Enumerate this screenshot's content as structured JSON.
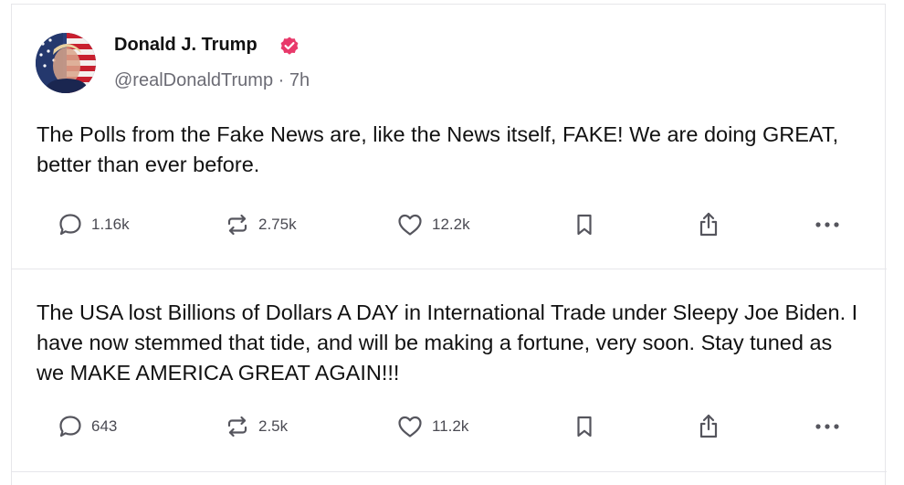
{
  "posts": [
    {
      "author": {
        "name": "Donald J. Trump",
        "handle": "@realDonaldTrump",
        "separator": "·",
        "time": "7h",
        "verified": true,
        "verified_color": "#e8396a"
      },
      "text": "The Polls from the Fake News are, like the News itself, FAKE! We are doing GREAT, better than ever before.",
      "actions": {
        "replies": "1.16k",
        "reposts": "2.75k",
        "likes": "12.2k"
      }
    },
    {
      "text": "The USA lost Billions of Dollars A DAY in International Trade under Sleepy Joe Biden. I have now stemmed that tide, and will be making a fortune, very soon. Stay tuned as we MAKE AMERICA GREAT AGAIN!!!",
      "actions": {
        "replies": "643",
        "reposts": "2.5k",
        "likes": "11.2k"
      }
    }
  ],
  "icons": {
    "reply": "speech-bubble-icon",
    "repost": "repost-arrows-icon",
    "like": "heart-icon",
    "bookmark": "bookmark-icon",
    "share": "share-upload-icon",
    "more": "more-dots-icon"
  },
  "colors": {
    "text": "#111111",
    "muted": "#6b6b74",
    "icon": "#55555d",
    "border": "#e6e6ea",
    "verified": "#e8396a"
  }
}
